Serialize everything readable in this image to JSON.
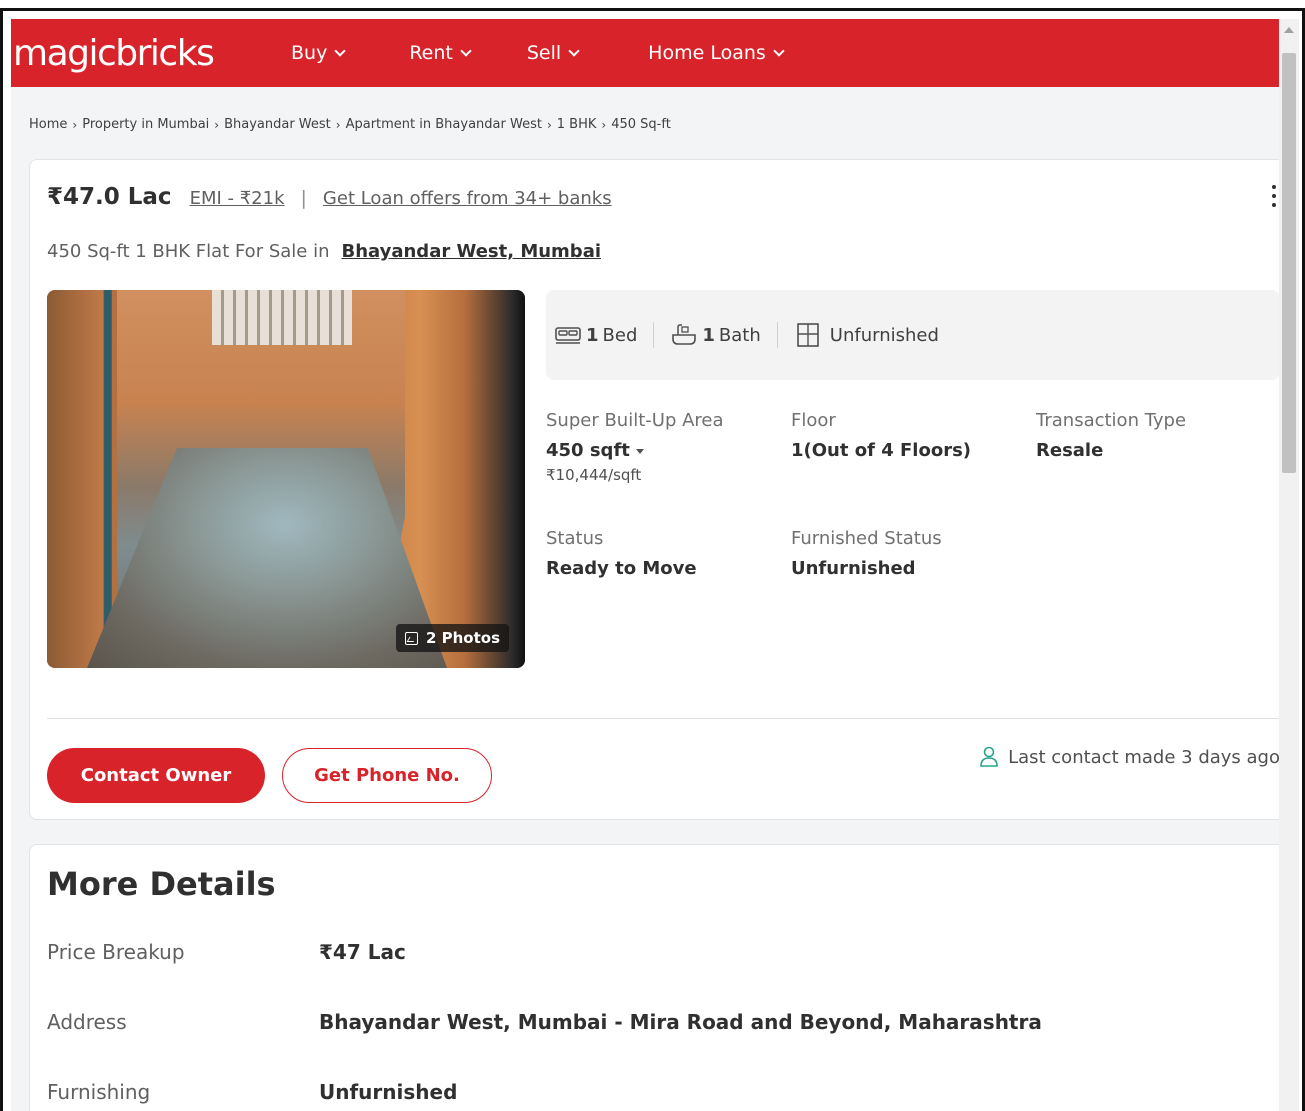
{
  "header": {
    "logo": "magicbricks",
    "nav": [
      "Buy",
      "Rent",
      "Sell",
      "Home Loans"
    ]
  },
  "breadcrumb": [
    "Home",
    "Property in Mumbai",
    "Bhayandar West",
    "Apartment in Bhayandar West",
    "1 BHK",
    "450 Sq-ft"
  ],
  "listing": {
    "price": "₹47.0 Lac",
    "emi": "EMI - ₹21k",
    "loan_link": "Get Loan offers from 34+ banks",
    "title_prefix": "450 Sq-ft 1 BHK Flat For Sale in",
    "title_location": "Bhayandar West, Mumbai",
    "photo_count": "2 Photos",
    "facts": {
      "bed_num": "1",
      "bed_label": "Bed",
      "bath_num": "1",
      "bath_label": "Bath",
      "furnishing": "Unfurnished"
    },
    "summary": {
      "area_label": "Super Built-Up Area",
      "area_value": "450 sqft",
      "area_rate": "₹10,444/sqft",
      "floor_label": "Floor",
      "floor_value": "1(Out of 4 Floors)",
      "transaction_label": "Transaction Type",
      "transaction_value": "Resale",
      "status_label": "Status",
      "status_value": "Ready to Move",
      "furnished_label": "Furnished Status",
      "furnished_value": "Unfurnished"
    },
    "contact_owner": "Contact Owner",
    "get_phone": "Get Phone No.",
    "last_contact": "Last contact made 3 days ago"
  },
  "more_details": {
    "title": "More Details",
    "rows": [
      {
        "label": "Price Breakup",
        "value": "₹47 Lac"
      },
      {
        "label": "Address",
        "value": "Bhayandar West, Mumbai - Mira Road and Beyond, Maharashtra"
      },
      {
        "label": "Furnishing",
        "value": "Unfurnished"
      }
    ]
  },
  "colors": {
    "brand_red": "#d8232a",
    "contact_icon": "#27a58b"
  },
  "icons": [
    "bed-icon",
    "bath-icon",
    "furniture-icon",
    "gallery-icon",
    "user-icon",
    "more-vertical-icon",
    "chevron-down-icon"
  ]
}
